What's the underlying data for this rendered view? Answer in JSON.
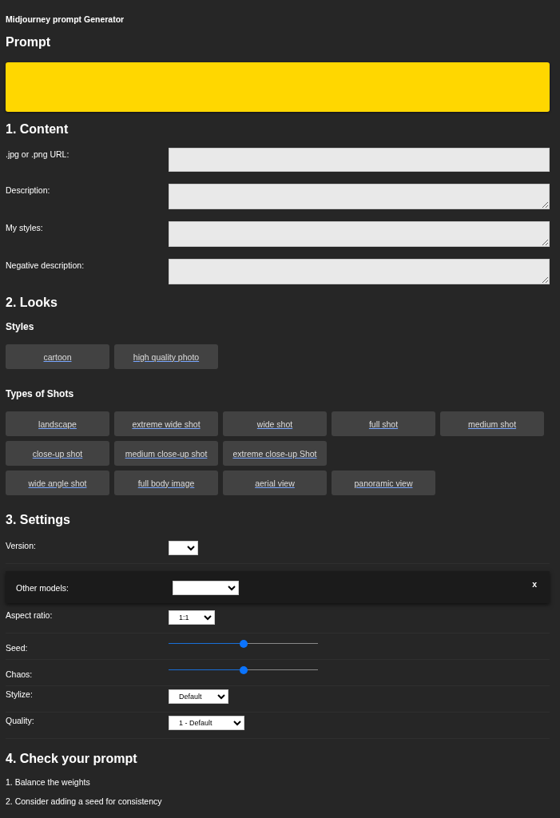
{
  "app_title": "Midjourney prompt Generator",
  "prompt": {
    "heading": "Prompt"
  },
  "content": {
    "heading": "1. Content",
    "fields": [
      {
        "label": ".jpg or .png URL:",
        "kind": "input"
      },
      {
        "label": "Description:",
        "kind": "textarea"
      },
      {
        "label": "My styles:",
        "kind": "textarea"
      },
      {
        "label": "Negative description:",
        "kind": "textarea"
      }
    ]
  },
  "looks": {
    "heading": "2. Looks",
    "groups": [
      {
        "title": "Styles",
        "rows": [
          [
            "cartoon",
            "high quality photo"
          ]
        ]
      },
      {
        "title": "Types of Shots",
        "rows": [
          [
            "landscape",
            "extreme wide shot",
            "wide shot",
            "full shot",
            "medium shot"
          ],
          [
            "close-up shot",
            "medium close-up shot",
            "extreme close-up Shot"
          ],
          [
            "wide angle shot",
            "full body image",
            "aerial view",
            "panoramic view"
          ]
        ]
      }
    ]
  },
  "settings": {
    "heading": "3. Settings",
    "rows": [
      {
        "label": "Version:",
        "kind": "select",
        "value": ""
      },
      {
        "label": "Other models:",
        "kind": "panel",
        "value": "",
        "close": "x"
      },
      {
        "label": "Aspect ratio:",
        "kind": "select",
        "value": "1:1"
      },
      {
        "label": "Seed:",
        "kind": "slider",
        "level": 0.5
      },
      {
        "label": "Chaos:",
        "kind": "slider",
        "level": 0.5
      },
      {
        "label": "Stylize:",
        "kind": "select",
        "value": "Default"
      },
      {
        "label": "Quality:",
        "kind": "select",
        "value": "1 - Default"
      }
    ]
  },
  "check": {
    "heading": "4. Check your prompt",
    "items": [
      "1. Balance the weights",
      "2. Consider adding a seed for consistency"
    ]
  }
}
